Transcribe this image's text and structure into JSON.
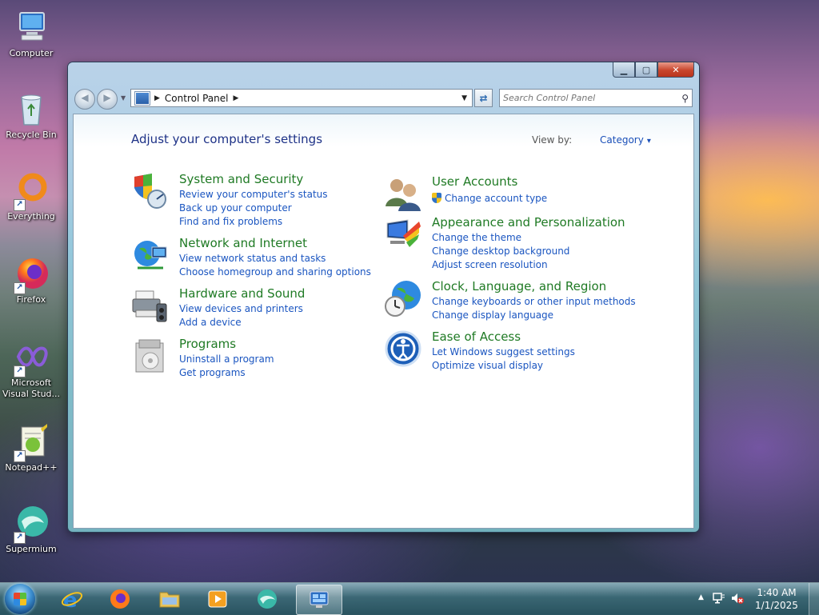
{
  "desktop": {
    "icons": [
      {
        "label": "Computer",
        "icon": "computer-icon"
      },
      {
        "label": "Recycle Bin",
        "icon": "recycle-bin-icon"
      },
      {
        "label": "Everything",
        "icon": "everything-icon"
      },
      {
        "label": "Firefox",
        "icon": "firefox-icon"
      },
      {
        "label": "Microsoft Visual Stud...",
        "icon": "visual-studio-icon"
      },
      {
        "label": "Notepad++",
        "icon": "notepad-plus-plus-icon"
      },
      {
        "label": "Supermium",
        "icon": "supermium-icon"
      }
    ]
  },
  "window": {
    "caption_buttons": {
      "minimize": "▁",
      "maximize": "▢",
      "close": "✕"
    },
    "nav": {
      "back": "◀",
      "forward": "▶"
    },
    "address": {
      "crumb": "Control Panel"
    },
    "search": {
      "placeholder": "Search Control Panel"
    },
    "heading": "Adjust your computer's settings",
    "view_by": {
      "label": "View by:",
      "value": "Category"
    },
    "categories_left": [
      {
        "title": "System and Security",
        "icon": "system-security-shield-icon",
        "links": [
          "Review your computer's status",
          "Back up your computer",
          "Find and fix problems"
        ]
      },
      {
        "title": "Network and Internet",
        "icon": "network-globe-icon",
        "links": [
          "View network status and tasks",
          "Choose homegroup and sharing options"
        ]
      },
      {
        "title": "Hardware and Sound",
        "icon": "printer-speaker-icon",
        "links": [
          "View devices and printers",
          "Add a device"
        ]
      },
      {
        "title": "Programs",
        "icon": "programs-box-icon",
        "links": [
          "Uninstall a program",
          "Get programs"
        ]
      }
    ],
    "categories_right": [
      {
        "title": "User Accounts",
        "icon": "user-accounts-icon",
        "links": [
          "Change account type"
        ]
      },
      {
        "title": "Appearance and Personalization",
        "icon": "monitor-colors-icon",
        "links": [
          "Change the theme",
          "Change desktop background",
          "Adjust screen resolution"
        ]
      },
      {
        "title": "Clock, Language, and Region",
        "icon": "globe-clock-icon",
        "links": [
          "Change keyboards or other input methods",
          "Change display language"
        ]
      },
      {
        "title": "Ease of Access",
        "icon": "ease-of-access-icon",
        "links": [
          "Let Windows suggest settings",
          "Optimize visual display"
        ]
      }
    ]
  },
  "taskbar": {
    "items": [
      "internet-explorer-icon",
      "firefox-icon",
      "file-explorer-icon",
      "media-player-icon",
      "supermium-icon",
      "control-panel-icon"
    ],
    "clock": {
      "time": "1:40 AM",
      "date": "1/1/2025"
    },
    "tray_arrow": "▲"
  },
  "colors": {
    "title_green": "#1f7a24",
    "link_blue": "#1a55c0",
    "heading_blue": "#1e3287"
  }
}
